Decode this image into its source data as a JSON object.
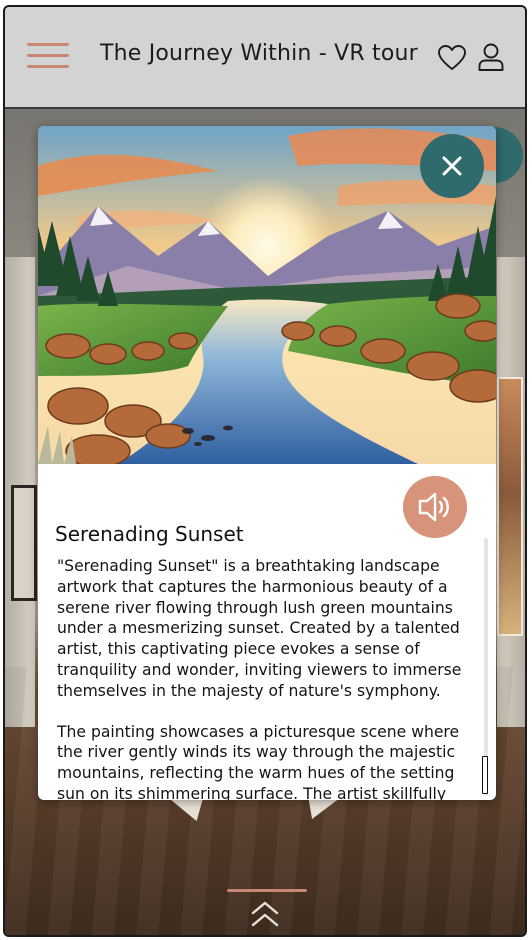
{
  "header": {
    "title": "The Journey Within - VR tour",
    "menu_icon": "hamburger-menu-icon",
    "favorite_icon": "heart-icon",
    "profile_icon": "user-icon"
  },
  "artwork": {
    "title": "Serenading Sunset",
    "description": [
      "\"Serenading Sunset\" is a breathtaking landscape artwork that captures the harmonious beauty of a serene river flowing through lush green mountains under a mesmerizing sunset. Created by a talented artist, this captivating piece evokes a sense of tranquility and wonder, inviting viewers to immerse themselves in the majesty of nature's symphony.",
      "The painting showcases a picturesque scene where the river gently winds its way through the majestic mountains, reflecting the warm hues of the setting sun on its shimmering surface. The artist skillfully"
    ],
    "close_icon": "close-icon",
    "audio_icon": "speaker-icon"
  },
  "footer": {
    "swipe_icon": "double-chevron-up-icon"
  },
  "colors": {
    "accent": "#c98670",
    "close_button": "#2f6a6d",
    "audio_button": "#d8937b",
    "header_bg": "#d3d3d3"
  }
}
